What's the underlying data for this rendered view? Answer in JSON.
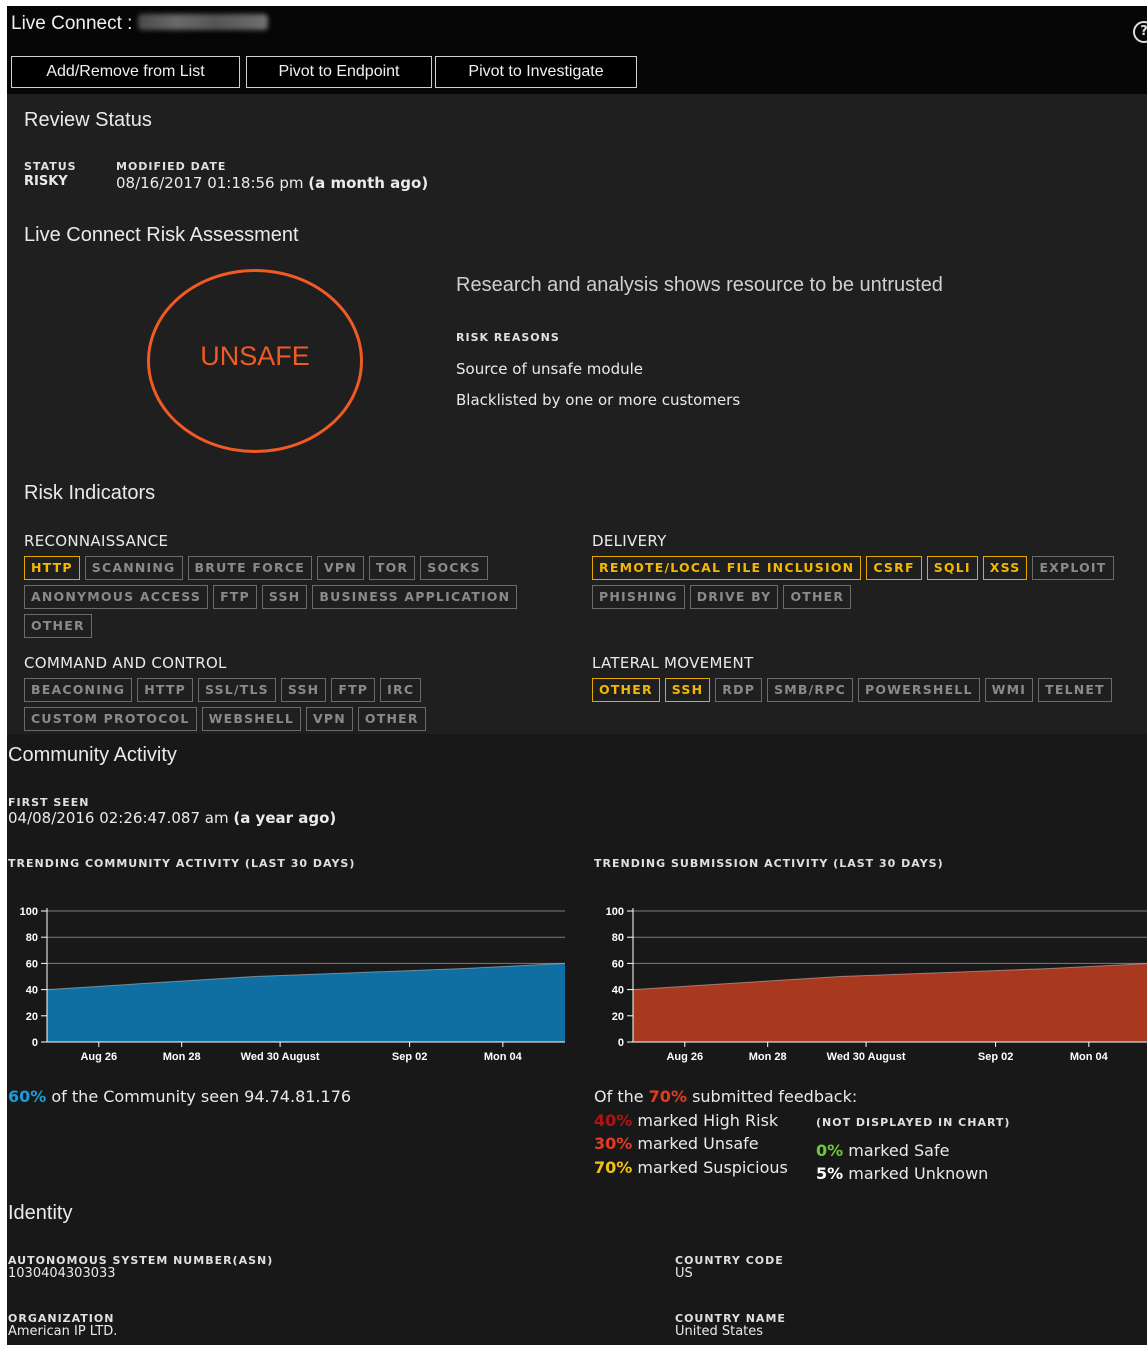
{
  "header": {
    "title": "Live Connect :",
    "help_icon": "?",
    "buttons": [
      "Add/Remove from List",
      "Pivot to Endpoint",
      "Pivot to Investigate"
    ]
  },
  "review": {
    "heading": "Review Status",
    "status_label": "STATUS",
    "status_value": "RISKY",
    "modified_label": "MODIFIED DATE",
    "modified_value": "08/16/2017 01:18:56 pm",
    "modified_relative": "(a month ago)"
  },
  "risk": {
    "heading": "Live Connect Risk Assessment",
    "verdict": "UNSAFE",
    "summary": "Research and analysis shows resource to be untrusted",
    "reasons_label": "RISK REASONS",
    "reasons": [
      "Source of unsafe module",
      "Blacklisted by one or more customers"
    ],
    "verdict_color": "#f05a24"
  },
  "indicators": {
    "heading": "Risk Indicators",
    "groups": [
      {
        "name": "RECONNAISSANCE",
        "tags": [
          {
            "label": "HTTP",
            "active": true
          },
          {
            "label": "SCANNING",
            "active": false
          },
          {
            "label": "BRUTE FORCE",
            "active": false
          },
          {
            "label": "VPN",
            "active": false
          },
          {
            "label": "TOR",
            "active": false
          },
          {
            "label": "SOCKS",
            "active": false
          },
          {
            "label": "ANONYMOUS ACCESS",
            "active": false
          },
          {
            "label": "FTP",
            "active": false
          },
          {
            "label": "SSH",
            "active": false
          },
          {
            "label": "BUSINESS APPLICATION",
            "active": false
          },
          {
            "label": "OTHER",
            "active": false
          }
        ]
      },
      {
        "name": "DELIVERY",
        "tags": [
          {
            "label": "REMOTE/LOCAL FILE INCLUSION",
            "active": true
          },
          {
            "label": "CSRF",
            "active": true
          },
          {
            "label": "SQLI",
            "active": true
          },
          {
            "label": "XSS",
            "active": true
          },
          {
            "label": "EXPLOIT",
            "active": false
          },
          {
            "label": "PHISHING",
            "active": false
          },
          {
            "label": "DRIVE BY",
            "active": false
          },
          {
            "label": "OTHER",
            "active": false
          }
        ]
      },
      {
        "name": "COMMAND AND CONTROL",
        "tags": [
          {
            "label": "BEACONING",
            "active": false
          },
          {
            "label": "HTTP",
            "active": false
          },
          {
            "label": "SSL/TLS",
            "active": false
          },
          {
            "label": "SSH",
            "active": false
          },
          {
            "label": "FTP",
            "active": false
          },
          {
            "label": "IRC",
            "active": false
          },
          {
            "label": "CUSTOM PROTOCOL",
            "active": false
          },
          {
            "label": "WEBSHELL",
            "active": false
          },
          {
            "label": "VPN",
            "active": false
          },
          {
            "label": "OTHER",
            "active": false
          }
        ]
      },
      {
        "name": "LATERAL MOVEMENT",
        "tags": [
          {
            "label": "OTHER",
            "active": true
          },
          {
            "label": "SSH",
            "active": true
          },
          {
            "label": "RDP",
            "active": false
          },
          {
            "label": "SMB/RPC",
            "active": false
          },
          {
            "label": "POWERSHELL",
            "active": false
          },
          {
            "label": "WMI",
            "active": false
          },
          {
            "label": "TELNET",
            "active": false
          }
        ]
      }
    ]
  },
  "community": {
    "heading": "Community Activity",
    "first_seen_label": "FIRST SEEN",
    "first_seen_value": "04/08/2016 02:26:47.087 am",
    "first_seen_relative": "(a year ago)",
    "community_chart_label": "TRENDING COMMUNITY ACTIVITY (LAST 30 DAYS)",
    "submission_chart_label": "TRENDING SUBMISSION ACTIVITY (LAST 30 DAYS)",
    "seen_pct": "60%",
    "seen_text": "of the Community seen 94.74.81.176",
    "feedback_prefix": "Of the",
    "feedback_pct": "70%",
    "feedback_suffix": "submitted feedback:",
    "high_risk_pct": "40%",
    "high_risk_text": "marked High Risk",
    "unsafe_pct": "30%",
    "unsafe_text": "marked Unsafe",
    "suspicious_pct": "70%",
    "suspicious_text": "marked Suspicious",
    "not_displayed": "(NOT DISPLAYED IN CHART)",
    "safe_pct": "0%",
    "safe_text": "marked Safe",
    "unknown_pct": "5%",
    "unknown_text": "marked Unknown"
  },
  "identity": {
    "heading": "Identity",
    "asn_label": "AUTONOMOUS SYSTEM NUMBER(ASN)",
    "asn_value": "1030404303033",
    "country_code_label": "COUNTRY CODE",
    "country_code_value": "US",
    "org_label": "ORGANIZATION",
    "org_value": "American IP LTD.",
    "country_name_label": "COUNTRY NAME",
    "country_name_value": "United States"
  },
  "chart_data": [
    {
      "type": "area",
      "x": [
        "Aug 26",
        "Mon 28",
        "Wed 30 August",
        "Sep 02",
        "Mon 04"
      ],
      "y": [
        40,
        45,
        50,
        53,
        56,
        60
      ],
      "ylim": [
        0,
        100
      ],
      "yticks": [
        0,
        20,
        40,
        60,
        80,
        100
      ],
      "grid": true,
      "color": "#0f6fa3"
    },
    {
      "type": "area",
      "x": [
        "Aug 26",
        "Mon 28",
        "Wed 30 August",
        "Sep 02",
        "Mon 04"
      ],
      "y": [
        40,
        45,
        50,
        53,
        56,
        60
      ],
      "ylim": [
        0,
        100
      ],
      "yticks": [
        0,
        20,
        40,
        60,
        80,
        100
      ],
      "grid": true,
      "color": "#a8381e"
    }
  ]
}
